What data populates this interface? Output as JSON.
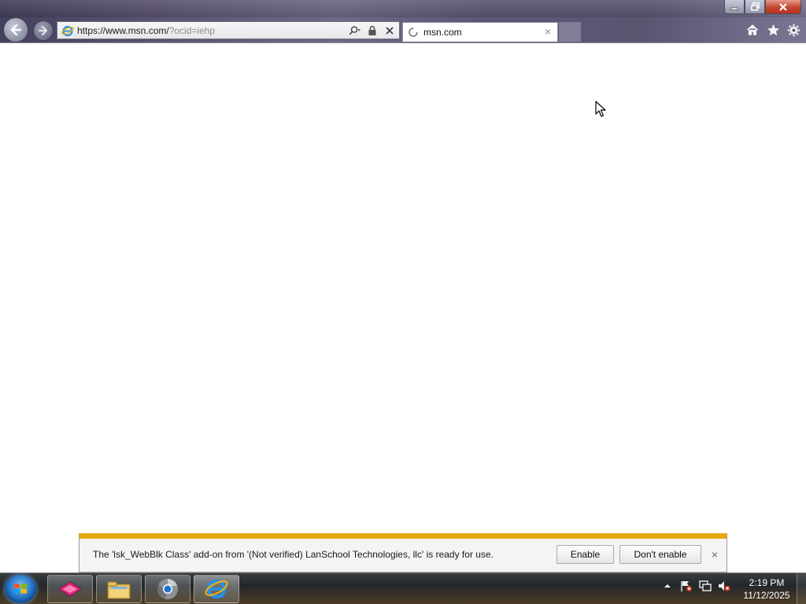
{
  "browser": {
    "address_bar": {
      "url_host": "https://www.msn.com/",
      "url_query": "?ocid=iehp"
    },
    "tab": {
      "title": "msn.com",
      "close_glyph": "×"
    },
    "window_controls": {
      "minimize_icon": "minimize-icon",
      "maximize_icon": "restore-icon",
      "close_icon": "close-icon"
    },
    "command_icons": [
      "home-icon",
      "favorites-star-icon",
      "tools-gear-icon"
    ]
  },
  "notification": {
    "message": "The 'lsk_WebBlk Class' add-on from '(Not verified) LanSchool Technologies, llc' is ready for use.",
    "enable_label": "Enable",
    "dont_enable_label": "Don't enable",
    "close_glyph": "×",
    "accent_color": "#e6a810"
  },
  "taskbar": {
    "pinned_apps": [
      "lanschool-app-icon",
      "file-explorer-icon",
      "chrome-icon",
      "internet-explorer-icon"
    ],
    "tray_icons": [
      "show-hidden-icons-arrow",
      "action-center-flag-icon",
      "network-icon",
      "volume-muted-icon"
    ],
    "clock": {
      "time": "2:19 PM",
      "date": "11/12/2025"
    }
  }
}
